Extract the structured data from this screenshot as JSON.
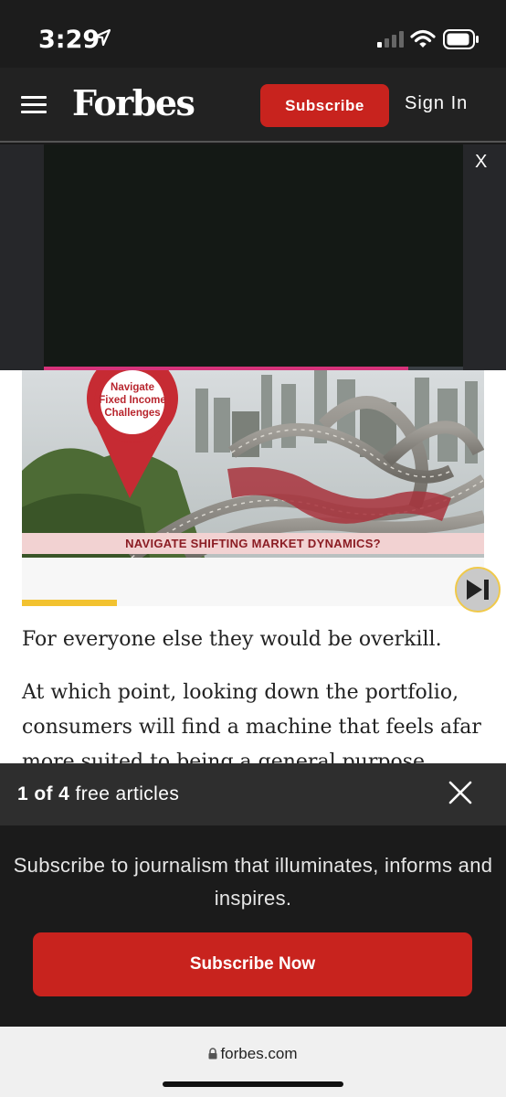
{
  "status_bar": {
    "time": "3:29"
  },
  "header": {
    "logo": "Forbes",
    "subscribe_label": "Subscribe",
    "signin_label": "Sign In"
  },
  "ad": {
    "close_label": "X",
    "progress": 0.87,
    "progress_color": "#d6337a"
  },
  "video": {
    "pin_text": [
      "Navigate",
      "Fixed Income",
      "Challenges"
    ],
    "banner_text": "NAVIGATE SHIFTING MARKET DYNAMICS?"
  },
  "article": {
    "paragraphs": [
      "For everyone else they would be overkill.",
      "At which point, looking down the portfolio, consumers will find a machine that feels afar more suited to being a general purpose laptop"
    ]
  },
  "paywall": {
    "count_strong": "1 of 4",
    "count_rest": " free articles",
    "message": "Subscribe to journalism that illuminates, informs and inspires.",
    "cta_label": "Subscribe Now"
  },
  "browser": {
    "url": "forbes.com"
  },
  "colors": {
    "brand_red": "#c8231e",
    "accent_yellow": "#f2c230"
  }
}
